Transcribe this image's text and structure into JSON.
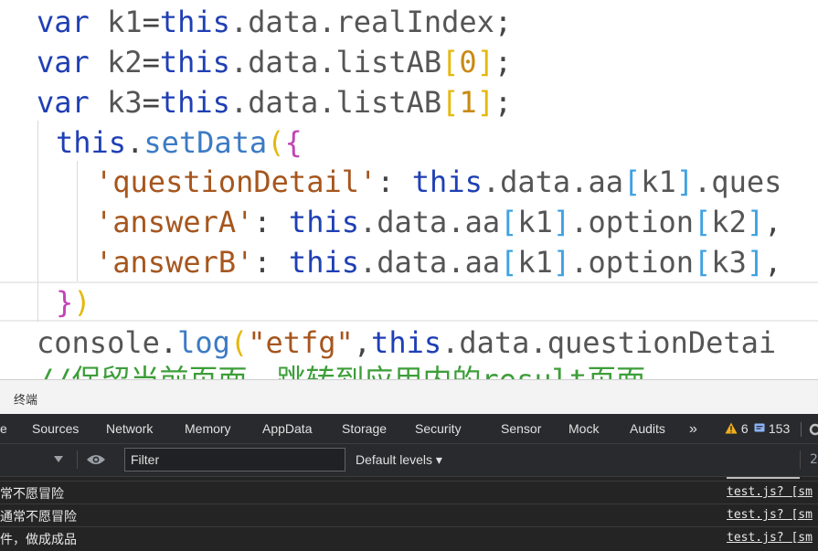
{
  "editor": {
    "lines": [
      [
        {
          "t": "var",
          "c": "kw"
        },
        {
          "t": " k1",
          "c": "id"
        },
        {
          "t": "=",
          "c": "op"
        },
        {
          "t": "this",
          "c": "kw"
        },
        {
          "t": ".data.realIndex",
          "c": "prop"
        },
        {
          "t": ";",
          "c": "op"
        }
      ],
      [
        {
          "t": "var",
          "c": "kw"
        },
        {
          "t": " k2",
          "c": "id"
        },
        {
          "t": "=",
          "c": "op"
        },
        {
          "t": "this",
          "c": "kw"
        },
        {
          "t": ".data.listAB",
          "c": "prop"
        },
        {
          "t": "[",
          "c": "br1"
        },
        {
          "t": "0",
          "c": "num"
        },
        {
          "t": "]",
          "c": "br1"
        },
        {
          "t": ";",
          "c": "op"
        }
      ],
      [
        {
          "t": "var",
          "c": "kw"
        },
        {
          "t": " k3",
          "c": "id"
        },
        {
          "t": "=",
          "c": "op"
        },
        {
          "t": "this",
          "c": "kw"
        },
        {
          "t": ".data.listAB",
          "c": "prop"
        },
        {
          "t": "[",
          "c": "br1"
        },
        {
          "t": "1",
          "c": "num"
        },
        {
          "t": "]",
          "c": "br1"
        },
        {
          "t": ";",
          "c": "op"
        }
      ],
      [
        {
          "t": "this",
          "c": "kw"
        },
        {
          "t": ".",
          "c": "op"
        },
        {
          "t": "setData",
          "c": "fn"
        },
        {
          "t": "(",
          "c": "br1"
        },
        {
          "t": "{",
          "c": "br2"
        }
      ],
      [
        {
          "t": "'questionDetail'",
          "c": "str"
        },
        {
          "t": ": ",
          "c": "op"
        },
        {
          "t": "this",
          "c": "kw"
        },
        {
          "t": ".data.aa",
          "c": "prop"
        },
        {
          "t": "[",
          "c": "br3"
        },
        {
          "t": "k1",
          "c": "id"
        },
        {
          "t": "]",
          "c": "br3"
        },
        {
          "t": ".ques",
          "c": "prop"
        }
      ],
      [
        {
          "t": "'answerA'",
          "c": "str"
        },
        {
          "t": ": ",
          "c": "op"
        },
        {
          "t": "this",
          "c": "kw"
        },
        {
          "t": ".data.aa",
          "c": "prop"
        },
        {
          "t": "[",
          "c": "br3"
        },
        {
          "t": "k1",
          "c": "id"
        },
        {
          "t": "]",
          "c": "br3"
        },
        {
          "t": ".option",
          "c": "prop"
        },
        {
          "t": "[",
          "c": "br3"
        },
        {
          "t": "k2",
          "c": "id"
        },
        {
          "t": "]",
          "c": "br3"
        },
        {
          "t": ",",
          "c": "op"
        }
      ],
      [
        {
          "t": "'answerB'",
          "c": "str"
        },
        {
          "t": ": ",
          "c": "op"
        },
        {
          "t": "this",
          "c": "kw"
        },
        {
          "t": ".data.aa",
          "c": "prop"
        },
        {
          "t": "[",
          "c": "br3"
        },
        {
          "t": "k1",
          "c": "id"
        },
        {
          "t": "]",
          "c": "br3"
        },
        {
          "t": ".option",
          "c": "prop"
        },
        {
          "t": "[",
          "c": "br3"
        },
        {
          "t": "k3",
          "c": "id"
        },
        {
          "t": "]",
          "c": "br3"
        },
        {
          "t": ",",
          "c": "op"
        }
      ],
      [
        {
          "t": "}",
          "c": "br2"
        },
        {
          "t": ")",
          "c": "br1"
        }
      ],
      [
        {
          "t": "console",
          "c": "id"
        },
        {
          "t": ".",
          "c": "op"
        },
        {
          "t": "log",
          "c": "fn"
        },
        {
          "t": "(",
          "c": "br1"
        },
        {
          "t": "\"etfg\"",
          "c": "str2"
        },
        {
          "t": ",",
          "c": "op"
        },
        {
          "t": "this",
          "c": "kw"
        },
        {
          "t": ".data.questionDetai",
          "c": "prop"
        }
      ],
      [
        {
          "t": "//保留当前页面，跳转到应用内的result页面",
          "c": "cmt"
        }
      ]
    ]
  },
  "drawer": {
    "title": "终端",
    "tabs": [
      "e",
      "Sources",
      "Network",
      "Memory",
      "AppData",
      "Storage",
      "Security",
      "Sensor",
      "Mock",
      "Audits"
    ],
    "overflow": "»",
    "warnings": "6",
    "messages_count": "153",
    "filter_placeholder": "Filter",
    "levels": "Default levels ▾",
    "right_count": "2",
    "console": [
      {
        "text": "常不愿冒险",
        "source": "test.js? [sm"
      },
      {
        "text": "通常不愿冒险",
        "source": "test.js? [sm"
      },
      {
        "text": "件，做成成品",
        "source": "test.js? [sm"
      }
    ],
    "colors": {
      "warning": "#f2b01e",
      "panel": "#242424"
    }
  }
}
